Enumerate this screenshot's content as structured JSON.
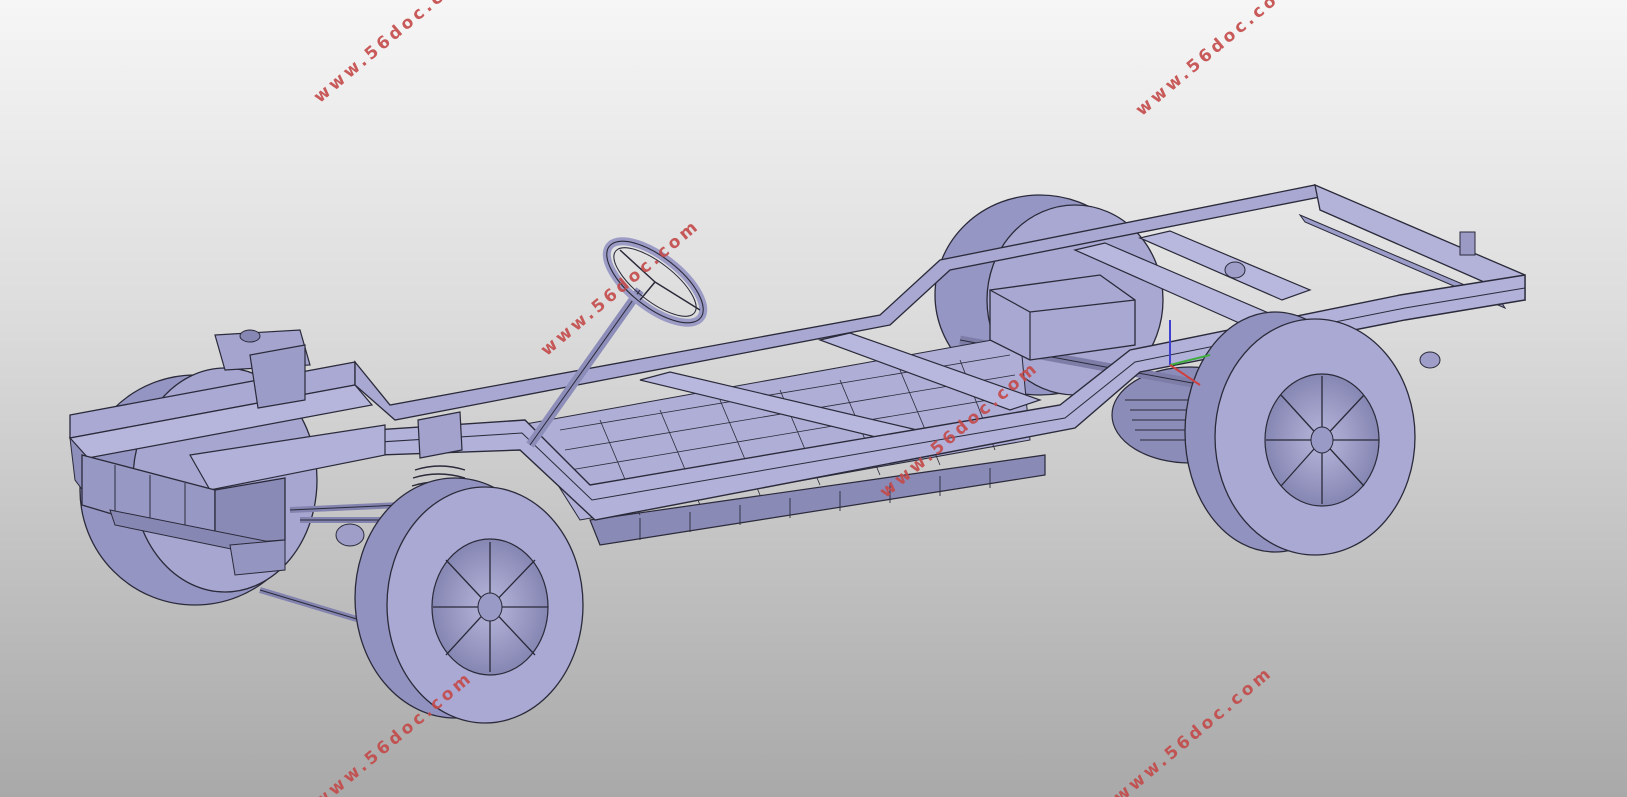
{
  "viewport": {
    "background_top": "#f6f6f6",
    "background_bottom": "#a9a9a9"
  },
  "model": {
    "part_fill": "#a6a6cf",
    "part_fill_light": "#b4b4da",
    "part_fill_dark": "#7d7da8",
    "edge_color": "#2a2a3a",
    "tire_side": "#8f8fbe",
    "components": [
      "ladder-frame",
      "steering-wheel",
      "battery-pack",
      "front-wheels",
      "rear-wheels",
      "coil-spring",
      "leaf-springs",
      "rear-axle",
      "motor-box"
    ]
  },
  "triad": {
    "x_color": "#d04040",
    "y_color": "#3fae3f",
    "z_color": "#4040d0"
  },
  "watermark": {
    "text": "www.56doc.com",
    "color": "#c44a4a"
  }
}
